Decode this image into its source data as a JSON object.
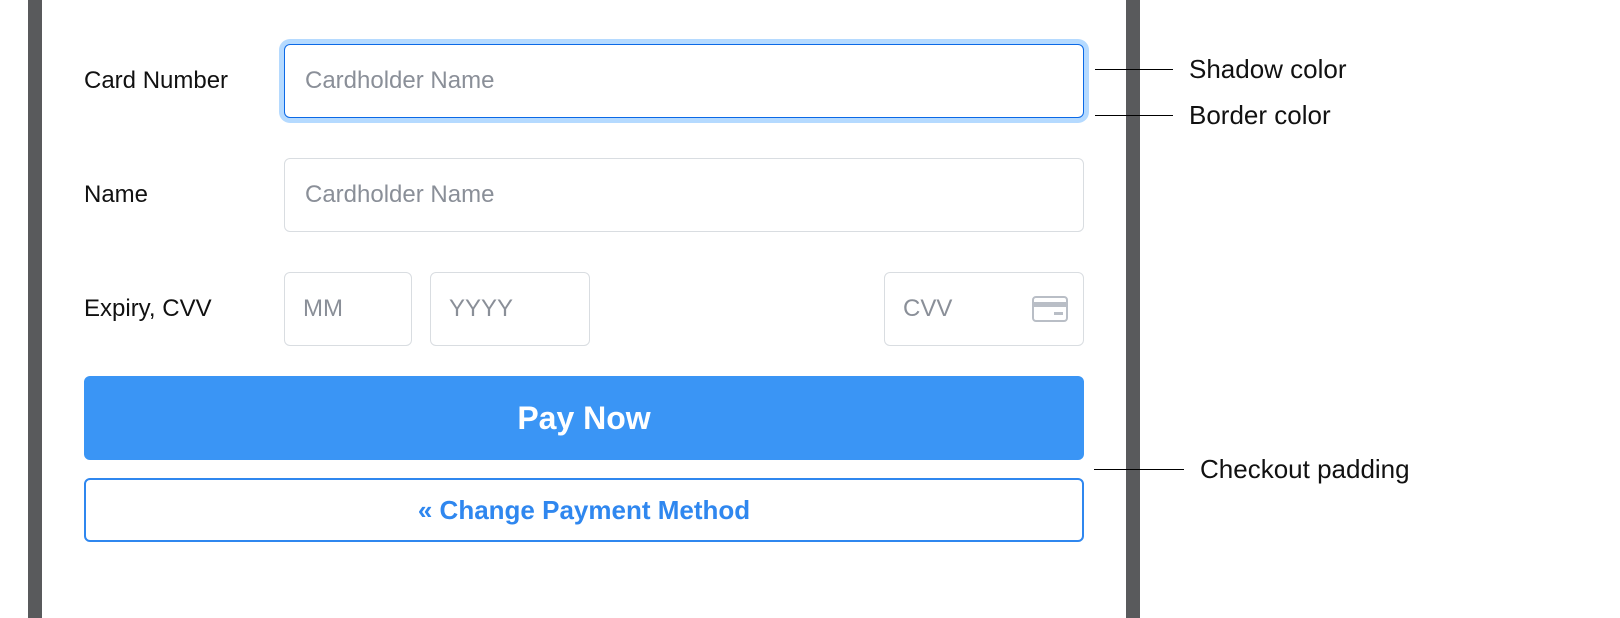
{
  "colors": {
    "focus_border": "#0b69e6",
    "focus_shadow": "#b5daff",
    "accent": "#3a95f5",
    "accent_border": "#2f87ef"
  },
  "form": {
    "card_number": {
      "label": "Card Number",
      "placeholder": "Cardholder Name",
      "value": ""
    },
    "name": {
      "label": "Name",
      "placeholder": "Cardholder Name",
      "value": ""
    },
    "expiry_cvv": {
      "label": "Expiry, CVV",
      "mm_placeholder": "MM",
      "yyyy_placeholder": "YYYY",
      "cvv_placeholder": "CVV"
    },
    "pay_button": "Pay Now",
    "change_method": "« Change Payment Method"
  },
  "annotations": {
    "shadow_color": "Shadow color",
    "border_color": "Border color",
    "checkout_padding": "Checkout padding"
  }
}
